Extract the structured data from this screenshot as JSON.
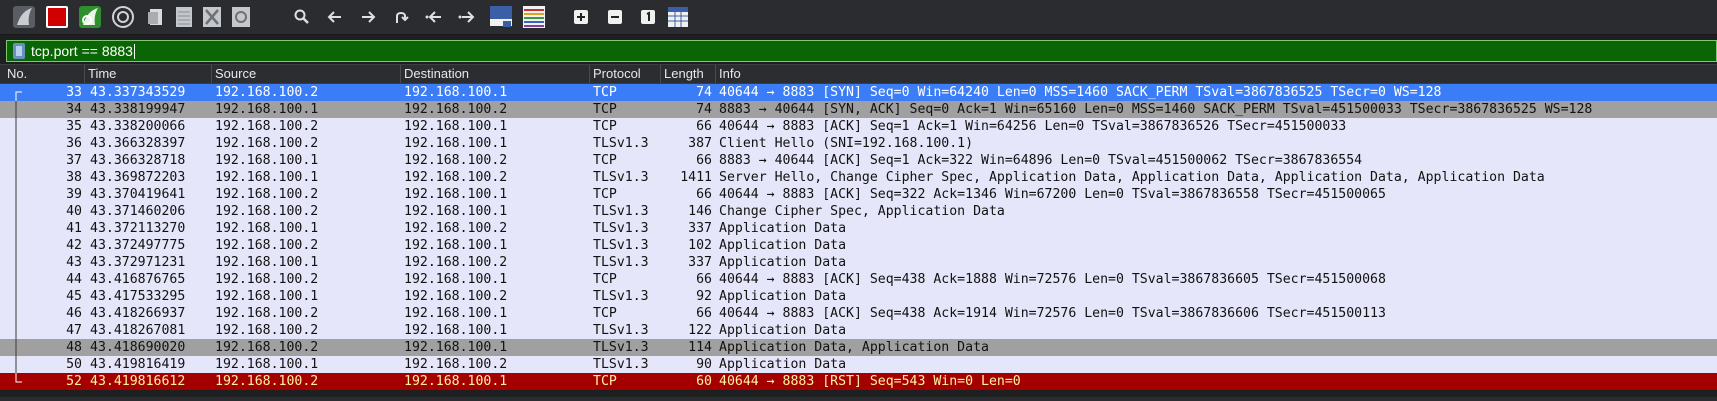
{
  "toolbar": {
    "icons": [
      "shark-fin-start-icon",
      "stop-capture-icon",
      "restart-capture-icon",
      "capture-options-icon",
      "open-file-icon",
      "save-file-icon",
      "close-file-icon",
      "reload-file-icon",
      "find-packet-icon",
      "go-back-icon",
      "go-forward-icon",
      "go-to-packet-icon",
      "first-packet-icon",
      "last-packet-icon",
      "autoscroll-icon",
      "colorize-icon",
      "zoom-in-icon",
      "zoom-out-icon",
      "normal-size-icon",
      "resize-columns-icon"
    ]
  },
  "filter": {
    "value": "tcp.port == 8883"
  },
  "columns": [
    "No.",
    "Time",
    "Source",
    "Destination",
    "Protocol",
    "Length",
    "Info"
  ],
  "colors": {
    "selected": "#3a7df6",
    "tcp": "#e6e6fa",
    "tls": "#e4e0f4",
    "grey": "#a0a0a0",
    "rst": "#a40000",
    "filter_valid": "#0a6604"
  },
  "packets": [
    {
      "no": "33",
      "time": "43.337343529",
      "src": "192.168.100.2",
      "dst": "192.168.100.1",
      "proto": "TCP",
      "len": "74",
      "info": "40644 → 8883 [SYN] Seq=0 Win=64240 Len=0 MSS=1460 SACK_PERM TSval=3867836525 TSecr=0 WS=128",
      "style": "selected"
    },
    {
      "no": "34",
      "time": "43.338199947",
      "src": "192.168.100.1",
      "dst": "192.168.100.2",
      "proto": "TCP",
      "len": "74",
      "info": "8883 → 40644 [SYN, ACK] Seq=0 Ack=1 Win=65160 Len=0 MSS=1460 SACK_PERM TSval=451500033 TSecr=3867836525 WS=128",
      "style": "grey"
    },
    {
      "no": "35",
      "time": "43.338200066",
      "src": "192.168.100.2",
      "dst": "192.168.100.1",
      "proto": "TCP",
      "len": "66",
      "info": "40644 → 8883 [ACK] Seq=1 Ack=1 Win=64256 Len=0 TSval=3867836526 TSecr=451500033",
      "style": "tcp"
    },
    {
      "no": "36",
      "time": "43.366328397",
      "src": "192.168.100.2",
      "dst": "192.168.100.1",
      "proto": "TLSv1.3",
      "len": "387",
      "info": "Client Hello (SNI=192.168.100.1)",
      "style": "tcp"
    },
    {
      "no": "37",
      "time": "43.366328718",
      "src": "192.168.100.1",
      "dst": "192.168.100.2",
      "proto": "TCP",
      "len": "66",
      "info": "8883 → 40644 [ACK] Seq=1 Ack=322 Win=64896 Len=0 TSval=451500062 TSecr=3867836554",
      "style": "tcp"
    },
    {
      "no": "38",
      "time": "43.369872203",
      "src": "192.168.100.1",
      "dst": "192.168.100.2",
      "proto": "TLSv1.3",
      "len": "1411",
      "info": "Server Hello, Change Cipher Spec, Application Data, Application Data, Application Data, Application Data",
      "style": "tcp"
    },
    {
      "no": "39",
      "time": "43.370419641",
      "src": "192.168.100.2",
      "dst": "192.168.100.1",
      "proto": "TCP",
      "len": "66",
      "info": "40644 → 8883 [ACK] Seq=322 Ack=1346 Win=67200 Len=0 TSval=3867836558 TSecr=451500065",
      "style": "tcp"
    },
    {
      "no": "40",
      "time": "43.371460206",
      "src": "192.168.100.2",
      "dst": "192.168.100.1",
      "proto": "TLSv1.3",
      "len": "146",
      "info": "Change Cipher Spec, Application Data",
      "style": "tcp"
    },
    {
      "no": "41",
      "time": "43.372113270",
      "src": "192.168.100.1",
      "dst": "192.168.100.2",
      "proto": "TLSv1.3",
      "len": "337",
      "info": "Application Data",
      "style": "tcp"
    },
    {
      "no": "42",
      "time": "43.372497775",
      "src": "192.168.100.2",
      "dst": "192.168.100.1",
      "proto": "TLSv1.3",
      "len": "102",
      "info": "Application Data",
      "style": "tcp"
    },
    {
      "no": "43",
      "time": "43.372971231",
      "src": "192.168.100.1",
      "dst": "192.168.100.2",
      "proto": "TLSv1.3",
      "len": "337",
      "info": "Application Data",
      "style": "tcp"
    },
    {
      "no": "44",
      "time": "43.416876765",
      "src": "192.168.100.2",
      "dst": "192.168.100.1",
      "proto": "TCP",
      "len": "66",
      "info": "40644 → 8883 [ACK] Seq=438 Ack=1888 Win=72576 Len=0 TSval=3867836605 TSecr=451500068",
      "style": "tcp"
    },
    {
      "no": "45",
      "time": "43.417533295",
      "src": "192.168.100.1",
      "dst": "192.168.100.2",
      "proto": "TLSv1.3",
      "len": "92",
      "info": "Application Data",
      "style": "tcp"
    },
    {
      "no": "46",
      "time": "43.418266937",
      "src": "192.168.100.2",
      "dst": "192.168.100.1",
      "proto": "TCP",
      "len": "66",
      "info": "40644 → 8883 [ACK] Seq=438 Ack=1914 Win=72576 Len=0 TSval=3867836606 TSecr=451500113",
      "style": "tcp"
    },
    {
      "no": "47",
      "time": "43.418267081",
      "src": "192.168.100.2",
      "dst": "192.168.100.1",
      "proto": "TLSv1.3",
      "len": "122",
      "info": "Application Data",
      "style": "tcp"
    },
    {
      "no": "48",
      "time": "43.418690020",
      "src": "192.168.100.2",
      "dst": "192.168.100.1",
      "proto": "TLSv1.3",
      "len": "114",
      "info": "Application Data, Application Data",
      "style": "grey"
    },
    {
      "no": "50",
      "time": "43.419816419",
      "src": "192.168.100.1",
      "dst": "192.168.100.2",
      "proto": "TLSv1.3",
      "len": "90",
      "info": "Application Data",
      "style": "tcp"
    },
    {
      "no": "52",
      "time": "43.419816612",
      "src": "192.168.100.2",
      "dst": "192.168.100.1",
      "proto": "TCP",
      "len": "60",
      "info": "40644 → 8883 [RST] Seq=543 Win=0 Len=0",
      "style": "rst"
    }
  ]
}
